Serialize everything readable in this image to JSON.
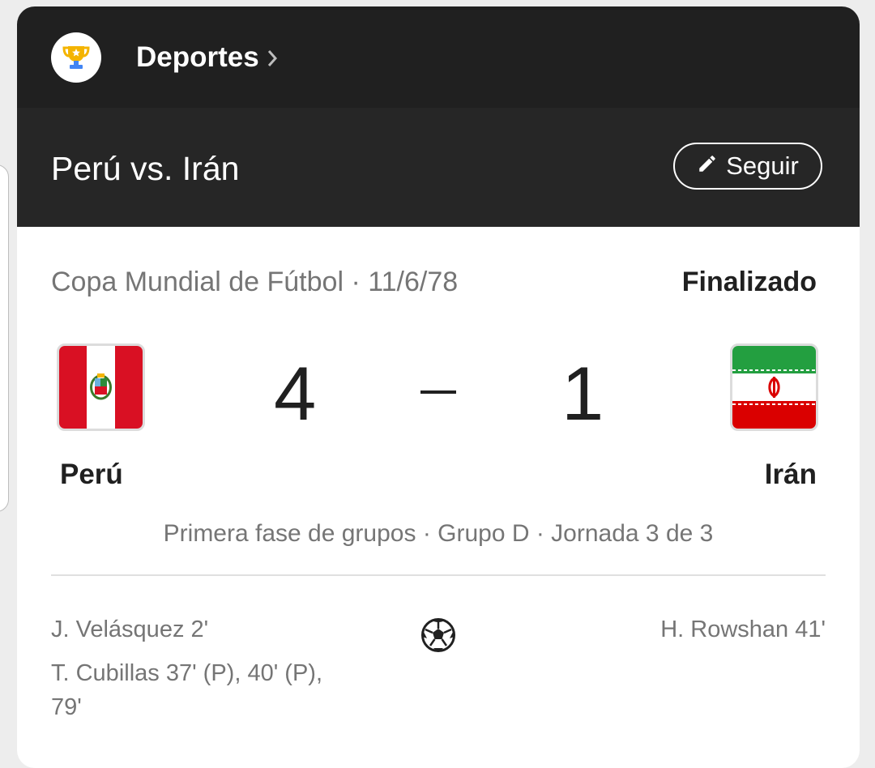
{
  "header": {
    "category_label": "Deportes",
    "trophy_icon": "trophy-icon",
    "chevron_icon": "chevron-right-icon"
  },
  "match_header": {
    "title": "Perú vs. Irán",
    "follow_label": "Seguir",
    "follow_icon": "pencil-icon"
  },
  "match": {
    "competition": "Copa Mundial de Fútbol · 11/6/78",
    "status": "Finalizado",
    "home": {
      "name": "Perú",
      "score": "4",
      "flag": "peru-flag"
    },
    "away": {
      "name": "Irán",
      "score": "1",
      "flag": "iran-flag"
    },
    "separator": "–",
    "stage": "Primera fase de grupos · Grupo D · Jornada 3 de 3"
  },
  "goals": {
    "icon": "soccer-ball-icon",
    "home_scorers": [
      {
        "line1": "J. Velásquez 2'",
        "line2": ""
      },
      {
        "line1": "T. Cubillas 37' (P), 40' (P),",
        "line2": "79'"
      }
    ],
    "away_scorers": [
      {
        "line1": "H. Rowshan 41'"
      }
    ]
  },
  "colors": {
    "header_bg": "#202020",
    "title_bg": "#262626",
    "peru_red": "#d91023",
    "iran_green": "#239f40",
    "iran_red": "#da0000"
  }
}
